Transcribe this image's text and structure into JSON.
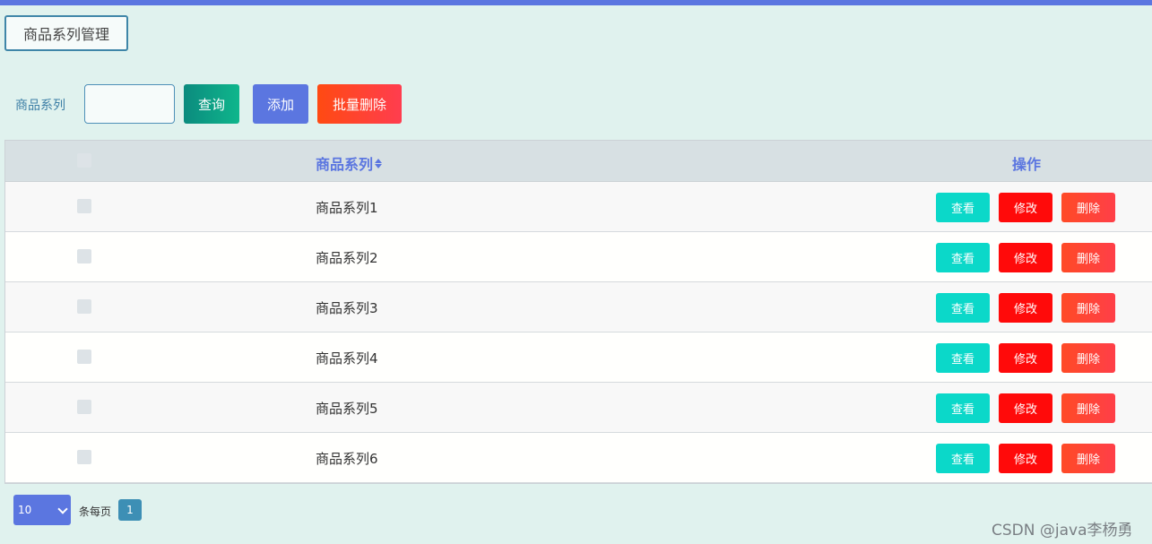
{
  "header": {
    "tag": "商品系列管理"
  },
  "search": {
    "label": "商品系列",
    "value": "",
    "placeholder": ""
  },
  "toolbar": {
    "query_label": "查询",
    "add_label": "添加",
    "batch_delete_label": "批量删除"
  },
  "table": {
    "columns": {
      "name": "商品系列",
      "operation": "操作"
    },
    "rows": [
      {
        "name": "商品系列1"
      },
      {
        "name": "商品系列2"
      },
      {
        "name": "商品系列3"
      },
      {
        "name": "商品系列4"
      },
      {
        "name": "商品系列5"
      },
      {
        "name": "商品系列6"
      }
    ],
    "actions": {
      "view": "查看",
      "edit": "修改",
      "delete": "删除"
    }
  },
  "pagination": {
    "page_size": "10",
    "per_page_label": "条每页",
    "current_page": "1"
  },
  "watermark": "CSDN @java李杨勇",
  "colors": {
    "accent": "#5b76e0",
    "view": "#0bd8c9",
    "edit": "#ff0a0a",
    "delete": "#ff4a26",
    "background": "#e0f2ee"
  }
}
